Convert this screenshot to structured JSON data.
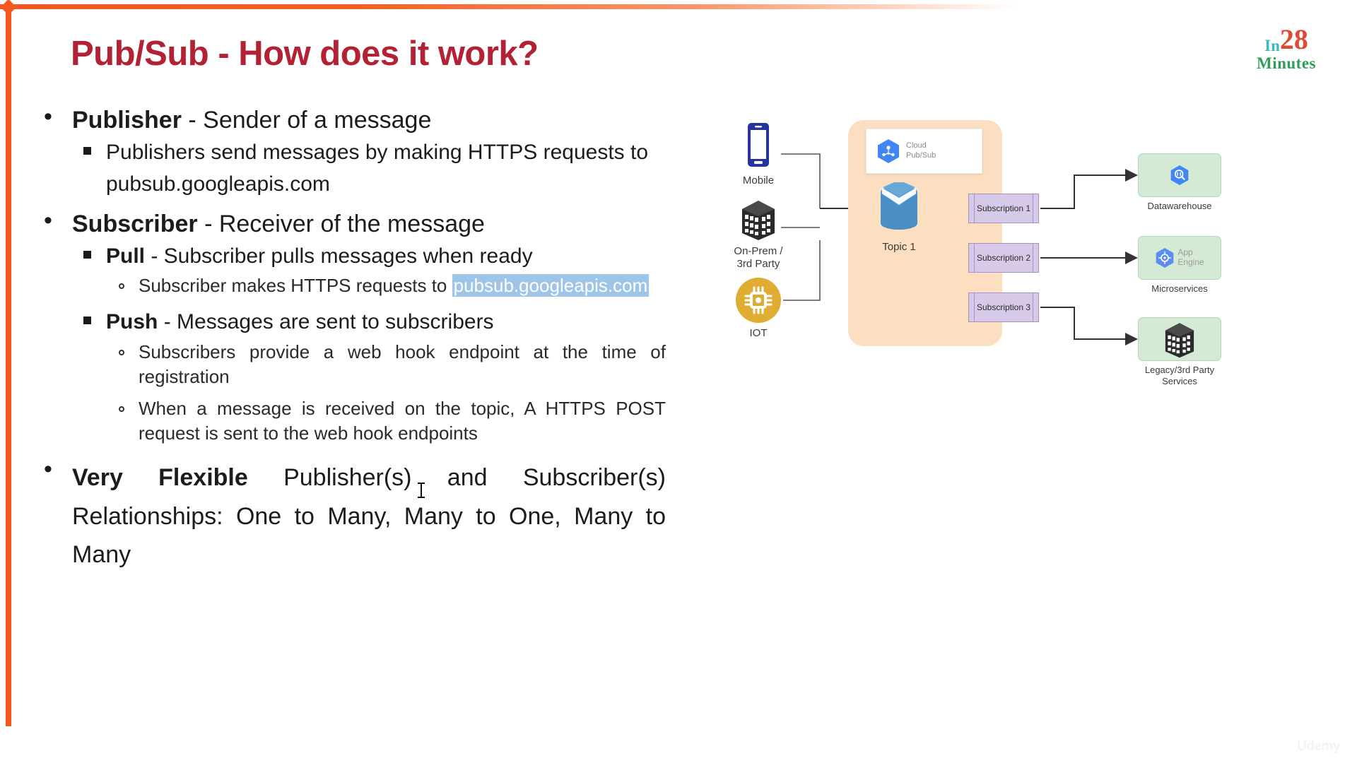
{
  "slide": {
    "title": "Pub/Sub - How does it work?",
    "title_color": "#b22234",
    "accent_color": "#f4581f",
    "watermark": "Udemy"
  },
  "logo": {
    "in": "In",
    "number": "28",
    "minutes": "Minutes",
    "in_color": "#3bb9c4",
    "number_color": "#e04a32",
    "minutes_color": "#2e9e57"
  },
  "bullets": {
    "publisher": {
      "bold": "Publisher",
      "rest": " - Sender of a message",
      "sub1": "Publishers send messages by making HTTPS requests to pubsub.googleapis.com"
    },
    "subscriber": {
      "bold": "Subscriber",
      "rest": " - Receiver of the message",
      "pull": {
        "bold": "Pull",
        "rest": " - Subscriber pulls messages when ready",
        "detail_before": "Subscriber makes HTTPS requests to ",
        "detail_selected": "pubsub.googleapis.com"
      },
      "push": {
        "bold": "Push",
        "rest": " - Messages are sent to subscribers",
        "detail1": "Subscribers provide a web hook endpoint at the time of registration",
        "detail2": "When a message is received on the topic, A HTTPS POST request is sent to the web hook endpoints"
      }
    },
    "flexible": {
      "bold": "Very Flexible",
      "rest": " Publisher(s) and Subscriber(s) Relationships: One to Many, Many to One, Many to Many"
    }
  },
  "diagram": {
    "sources": [
      {
        "label": "Mobile",
        "icon": "mobile-phone-icon"
      },
      {
        "label": "On-Prem / 3rd Party",
        "icon": "office-building-icon"
      },
      {
        "label": "IOT",
        "icon": "iot-chip-icon"
      }
    ],
    "cloud_card": {
      "line1": "Cloud",
      "line2": "Pub/Sub",
      "icon": "google-cloud-pubsub-icon"
    },
    "topic": {
      "label": "Topic 1",
      "icon": "topic-cylinder-icon"
    },
    "subscriptions": [
      {
        "label": "Subscription 1"
      },
      {
        "label": "Subscription 2"
      },
      {
        "label": "Subscription 3"
      }
    ],
    "destinations": [
      {
        "caption": "Datawarehouse",
        "icon": "bigquery-icon",
        "inner_text": ""
      },
      {
        "caption": "Microservices",
        "icon": "app-engine-icon",
        "inner_text": "App\nEngine"
      },
      {
        "caption": "Legacy/3rd Party Services",
        "icon": "office-building-icon",
        "inner_text": ""
      }
    ],
    "colors": {
      "panel": "#fcdfc0",
      "subscription": "#d7c9e8",
      "destination": "#d4ead4",
      "topic": "#4a90c4",
      "iot": "#e0ad33",
      "mobile": "#27349b"
    }
  }
}
